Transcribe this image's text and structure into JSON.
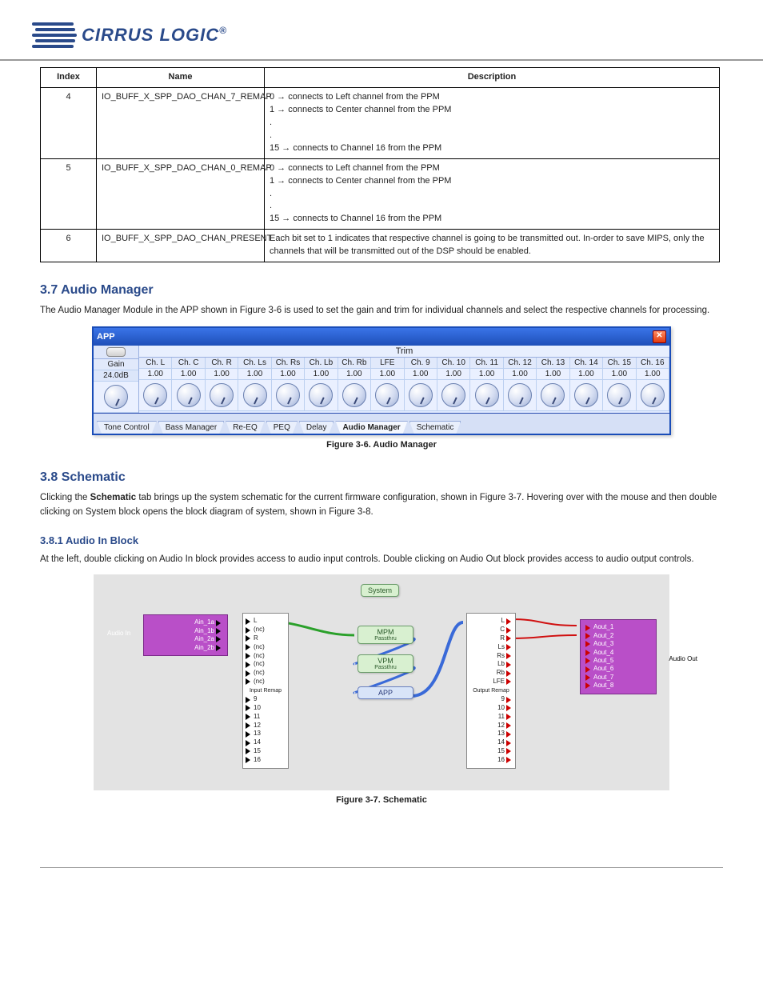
{
  "logo_text": "CIRRUS LOGIC",
  "logo_reg": "®",
  "table": {
    "headers": [
      "Index",
      "Name",
      "Description"
    ],
    "rows": [
      {
        "index": "4",
        "name": "IO_BUFF_X_SPP_DAO_CHAN_7_REMAP",
        "desc_lines": [
          "0 → connects to Left channel from the PPM",
          "1 → connects to Center channel from the PPM",
          ".",
          ".",
          "15 → connects to Channel 16 from the PPM"
        ]
      },
      {
        "index": "5",
        "name": "IO_BUFF_X_SPP_DAO_CHAN_0_REMAP",
        "desc_lines": [
          "0 → connects to Left channel from the PPM",
          "1 → connects to Center channel from the PPM",
          ".",
          ".",
          "15 → connects to Channel 16 from the PPM"
        ]
      },
      {
        "index": "6",
        "name": "IO_BUFF_X_SPP_DAO_CHAN_PRESENT",
        "desc_lines": [
          "Each bit set to 1 indicates that respective channel is going to be transmitted out. In-order to save MIPS, only the channels that will be transmitted out of the DSP should be enabled."
        ]
      }
    ]
  },
  "sections": {
    "s37": {
      "heading": "3.7 Audio Manager",
      "body": "The Audio Manager Module in the APP shown in Figure 3-6 is used to set the gain and trim for individual channels and select the respective channels for processing."
    },
    "s38": {
      "heading": "3.8 Schematic",
      "body1_prefix": "Clicking the ",
      "body1_term": "Schematic",
      "body1_rest": " tab brings up the system schematic for the current firmware configuration, shown in Figure 3-7. Hovering over with the mouse and then double clicking on System block opens the block diagram of system, shown in Figure 3-8.",
      "body2": "At the left, double clicking on Audio In block provides access to audio input controls. Double clicking on Audio Out block provides access to audio output controls."
    },
    "s381": {
      "heading": "3.8.1 Audio In Block"
    }
  },
  "fig36": {
    "title": "APP",
    "gain_label": "Gain",
    "gain_value": "24.0dB",
    "trim_label": "Trim",
    "channels": [
      "Ch. L",
      "Ch. C",
      "Ch. R",
      "Ch. Ls",
      "Ch. Rs",
      "Ch. Lb",
      "Ch. Rb",
      "LFE",
      "Ch. 9",
      "Ch. 10",
      "Ch. 11",
      "Ch. 12",
      "Ch. 13",
      "Ch. 14",
      "Ch. 15",
      "Ch. 16"
    ],
    "values": [
      "1.00",
      "1.00",
      "1.00",
      "1.00",
      "1.00",
      "1.00",
      "1.00",
      "1.00",
      "1.00",
      "1.00",
      "1.00",
      "1.00",
      "1.00",
      "1.00",
      "1.00",
      "1.00"
    ],
    "tabs": [
      "Tone Control",
      "Bass Manager",
      "Re-EQ",
      "PEQ",
      "Delay",
      "Audio Manager",
      "Schematic"
    ],
    "active_tab": "Audio Manager",
    "caption": "Figure 3-6. Audio Manager"
  },
  "fig37": {
    "caption": "Figure 3-7. Schematic",
    "system": "System",
    "mpm": "MPM",
    "mpm_sub": "Passthru",
    "vpm": "VPM",
    "vpm_sub": "Passthru",
    "app": "APP",
    "audio_in": "Audio In",
    "audio_out": "Audio Out",
    "ain": [
      "Ain_1a",
      "Ain_1b",
      "Ain_2a",
      "Ain_2b"
    ],
    "aout": [
      "Aout_1",
      "Aout_2",
      "Aout_3",
      "Aout_4",
      "Aout_5",
      "Aout_6",
      "Aout_7",
      "Aout_8"
    ],
    "in_remap": "Input Remap",
    "out_remap": "Output Remap",
    "in_labels_named": [
      "L",
      "(nc)",
      "R",
      "(nc)",
      "(nc)",
      "(nc)",
      "(nc)",
      "(nc)",
      "9",
      "10",
      "11",
      "12",
      "13",
      "14",
      "15",
      "16"
    ],
    "out_labels": [
      "L",
      "C",
      "R",
      "Ls",
      "Rs",
      "Lb",
      "Rb",
      "LFE",
      "9",
      "10",
      "11",
      "12",
      "13",
      "14",
      "15",
      "16"
    ]
  }
}
